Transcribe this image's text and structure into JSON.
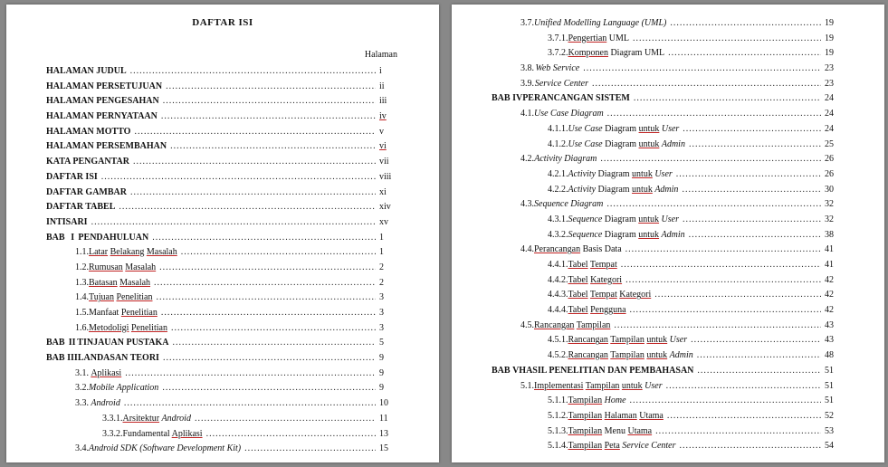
{
  "meta": {
    "title": "DAFTAR ISI",
    "col_header": "Halaman"
  },
  "left": [
    {
      "type": "front",
      "label": "HALAMAN JUDUL",
      "page": "i"
    },
    {
      "type": "front",
      "label": "HALAMAN PERSETUJUAN",
      "page": "ii"
    },
    {
      "type": "front",
      "label": "HALAMAN PENGESAHAN",
      "page": "iii"
    },
    {
      "type": "front",
      "label": "HALAMAN PERNYATAAN",
      "page": "iv",
      "page_ul": true
    },
    {
      "type": "front",
      "label": "HALAMAN MOTTO",
      "page": "v"
    },
    {
      "type": "front",
      "label": "HALAMAN PERSEMBAHAN",
      "page": "vi",
      "page_ul": true
    },
    {
      "type": "front",
      "label": "KATA PENGANTAR",
      "page": "vii"
    },
    {
      "type": "front",
      "label": "DAFTAR ISI",
      "page": "viii"
    },
    {
      "type": "front",
      "label": "DAFTAR GAMBAR",
      "page": "xi"
    },
    {
      "type": "front",
      "label": "DAFTAR TABEL",
      "page": "xiv"
    },
    {
      "type": "front",
      "label": "INTISARI",
      "page": "xv"
    },
    {
      "type": "bab",
      "pre": "BAB",
      "roman": "I",
      "label": "PENDAHULUAN",
      "page": "1"
    },
    {
      "type": "s1",
      "num": "1.1.",
      "label": "Latar Belakang Masalah",
      "ul_parts": [
        "Latar",
        " ",
        "Belakang",
        " ",
        "Masalah"
      ],
      "ul_mask": [
        true,
        false,
        true,
        false,
        true
      ],
      "page": "1"
    },
    {
      "type": "s1",
      "num": "1.2.",
      "label": "Rumusan Masalah",
      "ul_parts": [
        "Rumusan",
        " ",
        "Masalah"
      ],
      "ul_mask": [
        true,
        false,
        true
      ],
      "page": "2"
    },
    {
      "type": "s1",
      "num": "1.3.",
      "label": "Batasan Masalah",
      "ul_parts": [
        "Batasan",
        " ",
        "Masalah"
      ],
      "ul_mask": [
        true,
        false,
        true
      ],
      "page": "2"
    },
    {
      "type": "s1",
      "num": "1.4.",
      "label": "Tujuan Penelitian",
      "ul_parts": [
        "Tujuan",
        " ",
        "Penelitian"
      ],
      "ul_mask": [
        true,
        false,
        true
      ],
      "page": "3"
    },
    {
      "type": "s1",
      "num": "1.5.",
      "label": "Manfaat Penelitian",
      "ul_parts": [
        "Manfaat",
        " ",
        "Penelitian"
      ],
      "ul_mask": [
        false,
        false,
        true
      ],
      "page": "3"
    },
    {
      "type": "s1",
      "num": "1.6.",
      "label": "Metodoligi Penelitian",
      "ul_parts": [
        "Metodoligi",
        " ",
        "Penelitian"
      ],
      "ul_mask": [
        true,
        false,
        true
      ],
      "page": "3"
    },
    {
      "type": "bab",
      "pre": "BAB",
      "roman": "II",
      "label": "TINJAUAN PUSTAKA",
      "page": "5"
    },
    {
      "type": "bab",
      "pre": "BAB",
      "roman": "III",
      "label": "LANDASAN TEORI",
      "page": "9"
    },
    {
      "type": "s1a",
      "num": "3.1.",
      "label": "Aplikasi",
      "ul_parts": [
        "Aplikasi"
      ],
      "ul_mask": [
        true
      ],
      "italic": false,
      "page": "9"
    },
    {
      "type": "s1a",
      "num": "3.2.",
      "label": "Mobile Application",
      "italic": true,
      "page": "9"
    },
    {
      "type": "s1a",
      "num": "3.3.",
      "label": "Android",
      "italic": true,
      "page": "10"
    },
    {
      "type": "s2",
      "num": "3.3.1.",
      "label": "Arsitektur Android",
      "ul_parts": [
        "Arsitektur",
        " ",
        "Android"
      ],
      "ul_mask": [
        true,
        false,
        false
      ],
      "italic_last": true,
      "page": "11"
    },
    {
      "type": "s2",
      "num": "3.3.2.",
      "label": "Fundamental Aplikasi",
      "ul_parts": [
        "Fundamental ",
        "Aplikasi"
      ],
      "ul_mask": [
        false,
        true
      ],
      "page": "13"
    },
    {
      "type": "s1a",
      "num": "3.4.",
      "label": "Android SDK (Software Development Kit)",
      "italic": true,
      "page": "15"
    }
  ],
  "right": [
    {
      "type": "s1a",
      "num": "3.7.",
      "label": "Unified Modelling Language (UML)",
      "italic": true,
      "page": "19"
    },
    {
      "type": "s2",
      "num": "3.7.1.",
      "label": "Pengertian UML",
      "ul_parts": [
        "Pengertian",
        " UML"
      ],
      "ul_mask": [
        true,
        false
      ],
      "page": "19"
    },
    {
      "type": "s2",
      "num": "3.7.2.",
      "label": "Komponen Diagram UML",
      "ul_parts": [
        "Komponen",
        " Diagram UML"
      ],
      "ul_mask": [
        true,
        false
      ],
      "page": "19"
    },
    {
      "type": "s1a",
      "num": "3.8.",
      "label": "Web Service",
      "italic": true,
      "page": "23"
    },
    {
      "type": "s1a",
      "num": "3.9.",
      "label": "Service Center",
      "italic": true,
      "page": "23"
    },
    {
      "type": "bab",
      "pre": "BAB",
      "roman": "IV",
      "label": "PERANCANGAN SISTEM",
      "page": "24"
    },
    {
      "type": "s1a",
      "num": "4.1.",
      "label": "Use Case Diagram",
      "italic": true,
      "page": "24"
    },
    {
      "type": "s2",
      "num": "4.1.1.",
      "parts": [
        {
          "t": "Use Case",
          "i": true
        },
        {
          "t": " Diagram ",
          "i": false
        },
        {
          "t": "untuk",
          "u": true
        },
        {
          "t": " ",
          "i": false
        },
        {
          "t": "User",
          "i": true
        }
      ],
      "page": "24"
    },
    {
      "type": "s2",
      "num": "4.1.2.",
      "parts": [
        {
          "t": "Use Case",
          "i": true
        },
        {
          "t": " Diagram ",
          "i": false
        },
        {
          "t": "untuk",
          "u": true
        },
        {
          "t": " ",
          "i": false
        },
        {
          "t": "Admin",
          "i": true
        }
      ],
      "page": "25"
    },
    {
      "type": "s1a",
      "num": "4.2.",
      "label": "Activity Diagram",
      "italic": true,
      "page": "26"
    },
    {
      "type": "s2",
      "num": "4.2.1.",
      "parts": [
        {
          "t": "Activity",
          "i": true
        },
        {
          "t": " Diagram ",
          "i": false
        },
        {
          "t": "untuk",
          "u": true
        },
        {
          "t": " ",
          "i": false
        },
        {
          "t": "User",
          "i": true
        }
      ],
      "page": "26"
    },
    {
      "type": "s2",
      "num": "4.2.2.",
      "parts": [
        {
          "t": "Activity",
          "i": true
        },
        {
          "t": " Diagram ",
          "i": false
        },
        {
          "t": "untuk",
          "u": true
        },
        {
          "t": " ",
          "i": false
        },
        {
          "t": "Admin",
          "i": true
        }
      ],
      "page": "30"
    },
    {
      "type": "s1a",
      "num": "4.3.",
      "label": "Sequence Diagram",
      "italic": true,
      "page": "32"
    },
    {
      "type": "s2",
      "num": "4.3.1.",
      "parts": [
        {
          "t": "Sequence",
          "i": true
        },
        {
          "t": " Diagram ",
          "i": false
        },
        {
          "t": "untuk",
          "u": true
        },
        {
          "t": " ",
          "i": false
        },
        {
          "t": "User",
          "i": true
        }
      ],
      "page": "32"
    },
    {
      "type": "s2",
      "num": "4.3.2.",
      "parts": [
        {
          "t": "Sequence",
          "i": true
        },
        {
          "t": " Diagram ",
          "i": false
        },
        {
          "t": "untuk",
          "u": true
        },
        {
          "t": " ",
          "i": false
        },
        {
          "t": "Admin",
          "i": true
        }
      ],
      "page": "38"
    },
    {
      "type": "s1a",
      "num": "4.4.",
      "parts": [
        {
          "t": "Perancangan",
          "u": true
        },
        {
          "t": " Basis Data"
        }
      ],
      "page": "41"
    },
    {
      "type": "s2",
      "num": "4.4.1.",
      "parts": [
        {
          "t": "Tabel",
          "u": true
        },
        {
          "t": " ",
          "i": false
        },
        {
          "t": "Tempat",
          "u": true
        }
      ],
      "page": "41"
    },
    {
      "type": "s2",
      "num": "4.4.2.",
      "parts": [
        {
          "t": "Tabel",
          "u": true
        },
        {
          "t": " ",
          "i": false
        },
        {
          "t": "Kategori",
          "u": true
        }
      ],
      "page": "42"
    },
    {
      "type": "s2",
      "num": "4.4.3.",
      "parts": [
        {
          "t": "Tabel",
          "u": true
        },
        {
          "t": " ",
          "i": false
        },
        {
          "t": "Tempat",
          "u": true
        },
        {
          "t": " ",
          "i": false
        },
        {
          "t": "Kategori",
          "u": true
        }
      ],
      "page": "42"
    },
    {
      "type": "s2",
      "num": "4.4.4.",
      "parts": [
        {
          "t": "Tabel",
          "u": true
        },
        {
          "t": " ",
          "i": false
        },
        {
          "t": "Pengguna",
          "u": true
        }
      ],
      "page": "42"
    },
    {
      "type": "s1a",
      "num": "4.5.",
      "parts": [
        {
          "t": "Rancangan",
          "u": true
        },
        {
          "t": " ",
          "i": false
        },
        {
          "t": "Tampilan",
          "u": true
        }
      ],
      "page": "43"
    },
    {
      "type": "s2",
      "num": "4.5.1.",
      "parts": [
        {
          "t": "Rancangan",
          "u": true
        },
        {
          "t": " ",
          "i": false
        },
        {
          "t": "Tampilan",
          "u": true
        },
        {
          "t": " ",
          "i": false
        },
        {
          "t": "untuk",
          "u": true
        },
        {
          "t": " ",
          "i": false
        },
        {
          "t": "User",
          "i": true
        }
      ],
      "page": "43"
    },
    {
      "type": "s2",
      "num": "4.5.2.",
      "parts": [
        {
          "t": "Rancangan",
          "u": true
        },
        {
          "t": " ",
          "i": false
        },
        {
          "t": "Tampilan",
          "u": true
        },
        {
          "t": " ",
          "i": false
        },
        {
          "t": "untuk",
          "u": true
        },
        {
          "t": " ",
          "i": false
        },
        {
          "t": "Admin",
          "i": true
        }
      ],
      "page": "48"
    },
    {
      "type": "bab",
      "pre": "BAB",
      "roman": "V",
      "label": "HASIL PENELITIAN DAN PEMBAHASAN",
      "page": "51"
    },
    {
      "type": "s1a",
      "num": "5.1.",
      "parts": [
        {
          "t": "Implementasi",
          "u": true
        },
        {
          "t": " ",
          "i": false
        },
        {
          "t": "Tampilan",
          "u": true
        },
        {
          "t": " ",
          "i": false
        },
        {
          "t": "untuk",
          "u": true
        },
        {
          "t": " ",
          "i": false
        },
        {
          "t": "User",
          "i": true
        }
      ],
      "page": "51"
    },
    {
      "type": "s2",
      "num": "5.1.1.",
      "parts": [
        {
          "t": "Tampilan",
          "u": true
        },
        {
          "t": " ",
          "i": false
        },
        {
          "t": "Home",
          "i": true
        }
      ],
      "page": "51"
    },
    {
      "type": "s2",
      "num": "5.1.2.",
      "parts": [
        {
          "t": "Tampilan",
          "u": true
        },
        {
          "t": " ",
          "i": false
        },
        {
          "t": "Halaman",
          "u": true
        },
        {
          "t": " ",
          "i": false
        },
        {
          "t": "Utama",
          "u": true
        }
      ],
      "page": "52"
    },
    {
      "type": "s2",
      "num": "5.1.3.",
      "parts": [
        {
          "t": "Tampilan",
          "u": true
        },
        {
          "t": " Menu ",
          "i": false
        },
        {
          "t": "Utama",
          "u": true
        }
      ],
      "page": "53"
    },
    {
      "type": "s2",
      "num": "5.1.4.",
      "parts": [
        {
          "t": "Tampilan",
          "u": true
        },
        {
          "t": " ",
          "i": false
        },
        {
          "t": "Peta",
          "u": true
        },
        {
          "t": " ",
          "i": false
        },
        {
          "t": "Service Center",
          "i": true
        }
      ],
      "page": "54"
    }
  ]
}
